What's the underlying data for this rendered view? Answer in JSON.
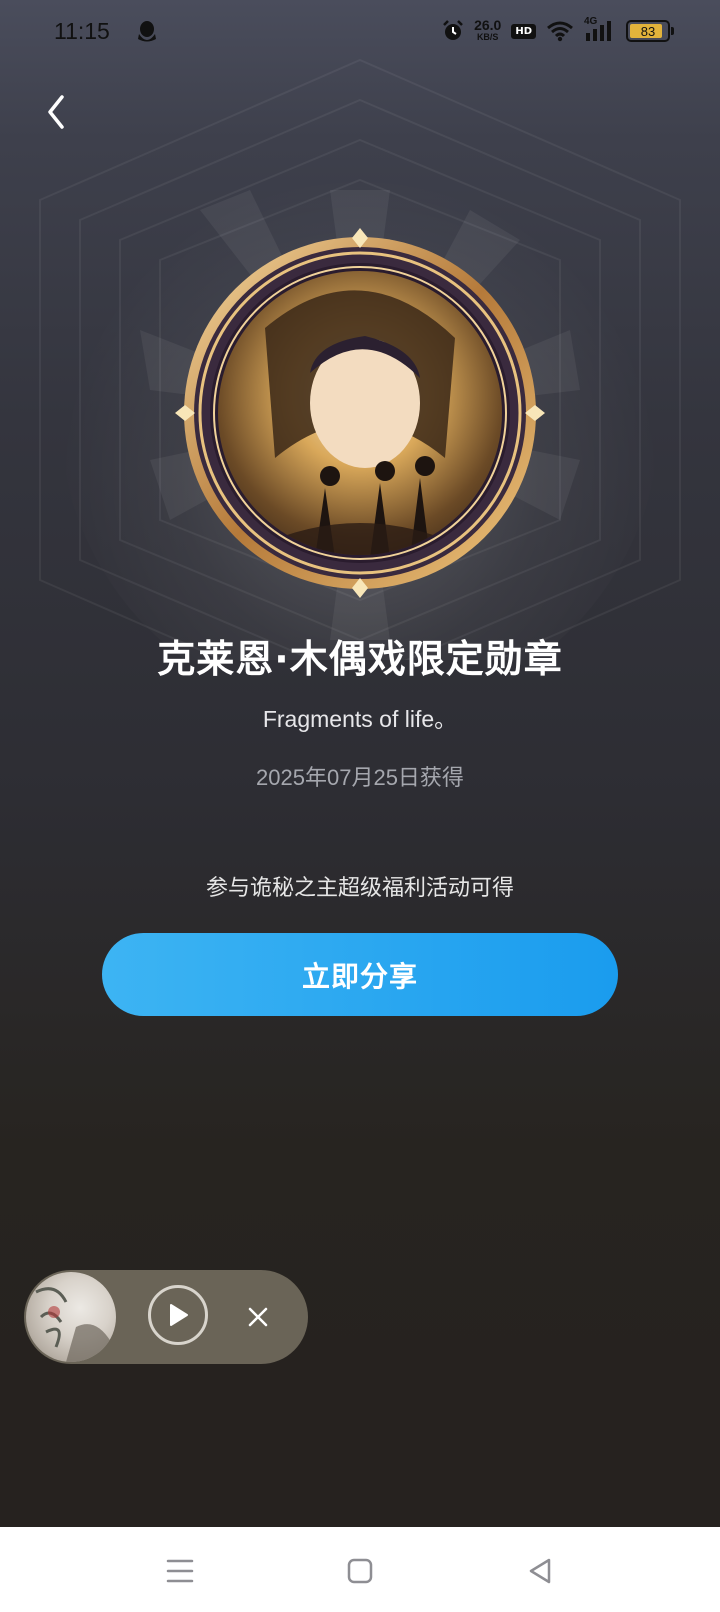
{
  "status_bar": {
    "time": "11:15",
    "network_speed": "26.0",
    "network_speed_unit": "KB/S",
    "hd_label": "HD",
    "signal_label": "4G",
    "battery_level": "83"
  },
  "badge": {
    "title": "克莱恩·木偶戏限定勋章",
    "subtitle": "Fragments of life。",
    "obtained_date": "2025年07月25日获得",
    "condition": "参与诡秘之主超级福利活动可得"
  },
  "share_button_label": "立即分享",
  "mini_player": {
    "state": "paused"
  },
  "colors": {
    "accent": "#1a9cee",
    "accent_light": "#3db4f3",
    "medal_gold": "#d9a85a",
    "player_bg": "#6a6457"
  }
}
